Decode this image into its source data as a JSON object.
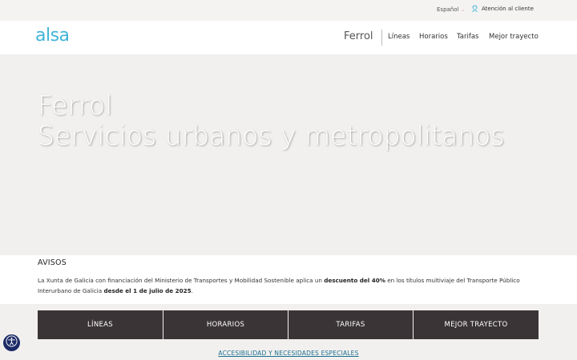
{
  "utility": {
    "language": "Español",
    "support": "Atención al cliente"
  },
  "header": {
    "logo": "alsa",
    "city": "Ferrol",
    "nav": [
      "Líneas",
      "Horarios",
      "Tarifas",
      "Mejor trayecto"
    ]
  },
  "hero": {
    "line1": "Ferrol",
    "line2": "Servicios urbanos y metropolitanos"
  },
  "notices": {
    "heading": "AVISOS",
    "text_before": "La Xunta de Galicia con financiación del Ministerio de Transportes y Mobilidad Sostenible aplica un ",
    "text_bold1": "descuento del 40%",
    "text_middle": " en los títulos multiviaje del Transporte Público Interurbano de Galicia ",
    "text_bold2": "desde el 1 de julio de 2025",
    "text_end": "."
  },
  "quicklinks": {
    "buttons": [
      "LÍNEAS",
      "HORARIOS",
      "TARIFAS",
      "MEJOR TRAYECTO"
    ],
    "accessibility": "ACCESIBILIDAD Y NECESIDADES ESPECIALES"
  },
  "colors": {
    "brand": "#3fb4d8",
    "button_bg": "#3a3437",
    "hero_bg": "#f2f0ef",
    "a11y_bg": "#1c2a66"
  },
  "icons": {
    "support": "agent-headset-icon",
    "language_chevron": "chevron-down-icon",
    "accessibility": "accessibility-icon"
  }
}
